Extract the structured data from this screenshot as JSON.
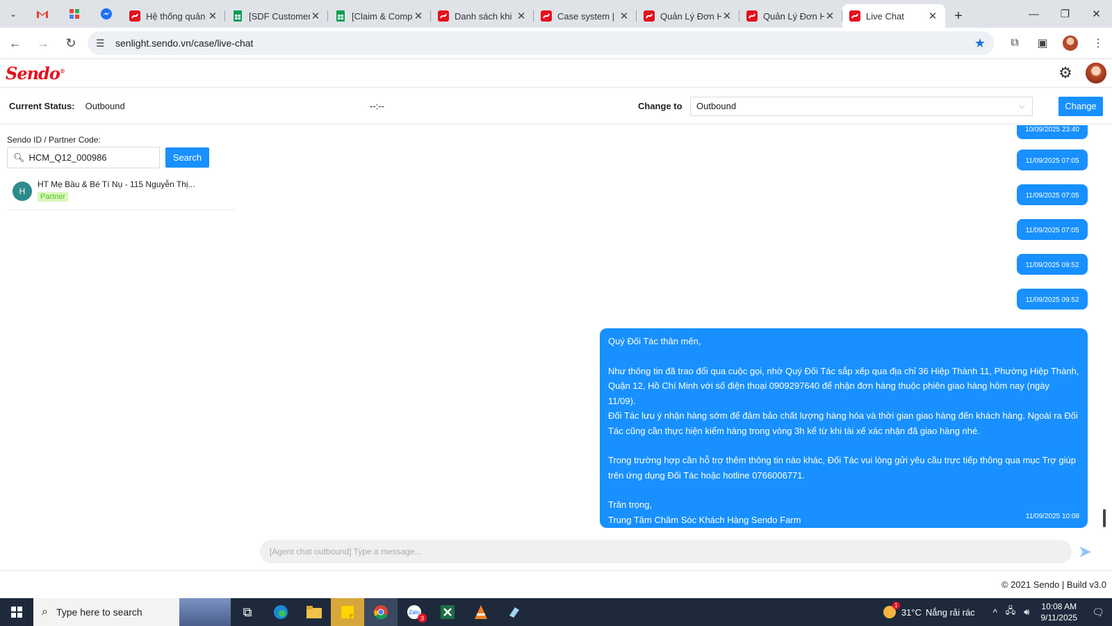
{
  "browser": {
    "tabs": [
      {
        "title": "Hệ thống quản",
        "icon": "sendo-icon"
      },
      {
        "title": "[SDF Customer",
        "icon": "sheets-icon"
      },
      {
        "title": "[Claim & Comp",
        "icon": "sheets-icon"
      },
      {
        "title": "Danh sách khi",
        "icon": "sendo-icon"
      },
      {
        "title": "Case system |",
        "icon": "sendo-icon"
      },
      {
        "title": "Quản Lý Đơn H",
        "icon": "sendo-icon"
      },
      {
        "title": "Quản Lý Đơn H",
        "icon": "sendo-icon"
      },
      {
        "title": "Live Chat",
        "icon": "sendo-icon"
      }
    ],
    "url": "senlight.sendo.vn/case/live-chat"
  },
  "app": {
    "logo": "Sendo",
    "status": {
      "current_label": "Current Status:",
      "current_value": "Outbound",
      "timer": "--:--",
      "change_label": "Change to",
      "select_value": "Outbound",
      "change_button": "Change"
    },
    "left": {
      "search_label": "Sendo ID / Partner Code:",
      "search_value": "HCM_Q12_000986",
      "search_button": "Search",
      "contact": {
        "avatar_letter": "H",
        "name": "HT Mẹ Bầu & Bé Tí Nụ - 115 Nguyễn Thị...",
        "tag": "Partner"
      }
    },
    "chat": {
      "time_bubbles": [
        "10/09/2025 23:40",
        "11/09/2025 07:05",
        "11/09/2025 07:05",
        "11/09/2025 07:05",
        "11/09/2025 09:52",
        "11/09/2025 09:52"
      ],
      "message": {
        "greeting": "Quý Đối Tác thân mến,",
        "p1_l1": "Như thông tin đã trao đổi qua cuộc gọi, nhờ Quý Đối Tác sắp xếp qua địa chỉ 36 Hiệp Thành 11, Phường Hiệp Thành,",
        "p1_l2": "Quận 12, Hồ Chí Minh với số điện thoại 0909297640 để nhận đơn hàng thuộc phiên giao hàng hôm nay (ngày 11/09).",
        "p1_l3": "Đối Tác lưu ý nhận hàng sớm để đảm bảo chất lượng hàng hóa và thời gian giao hàng đến khách hàng. Ngoài ra Đối",
        "p1_l4": "Tác cũng cần thực hiện kiểm hàng trong vòng 3h kể từ khi tài xế xác nhận đã giao hàng nhé.",
        "p2_l1": "Trong trường hợp cần hỗ trợ thêm thông tin nào khác, Đối Tác vui lòng gửi yêu cầu trực tiếp thông qua mục Trợ giúp",
        "p2_l2": "trên ứng dụng Đối Tác hoặc hotline 0766006771.",
        "closing": "Trân trọng,",
        "signature": "Trung Tâm Chăm Sóc Khách Hàng Sendo Farm",
        "time": "11/09/2025 10:08"
      },
      "input_placeholder": "[Agent chat outbound] Type a message..."
    },
    "footer": "© 2021 Sendo | Build v3.0"
  },
  "taskbar": {
    "search_placeholder": "Type here to search",
    "zalo_badge": "3",
    "weather_temp": "31°C",
    "weather_text": "Nắng rải rác",
    "weather_badge": "1",
    "time": "10:08 AM",
    "date": "9/11/2025"
  }
}
